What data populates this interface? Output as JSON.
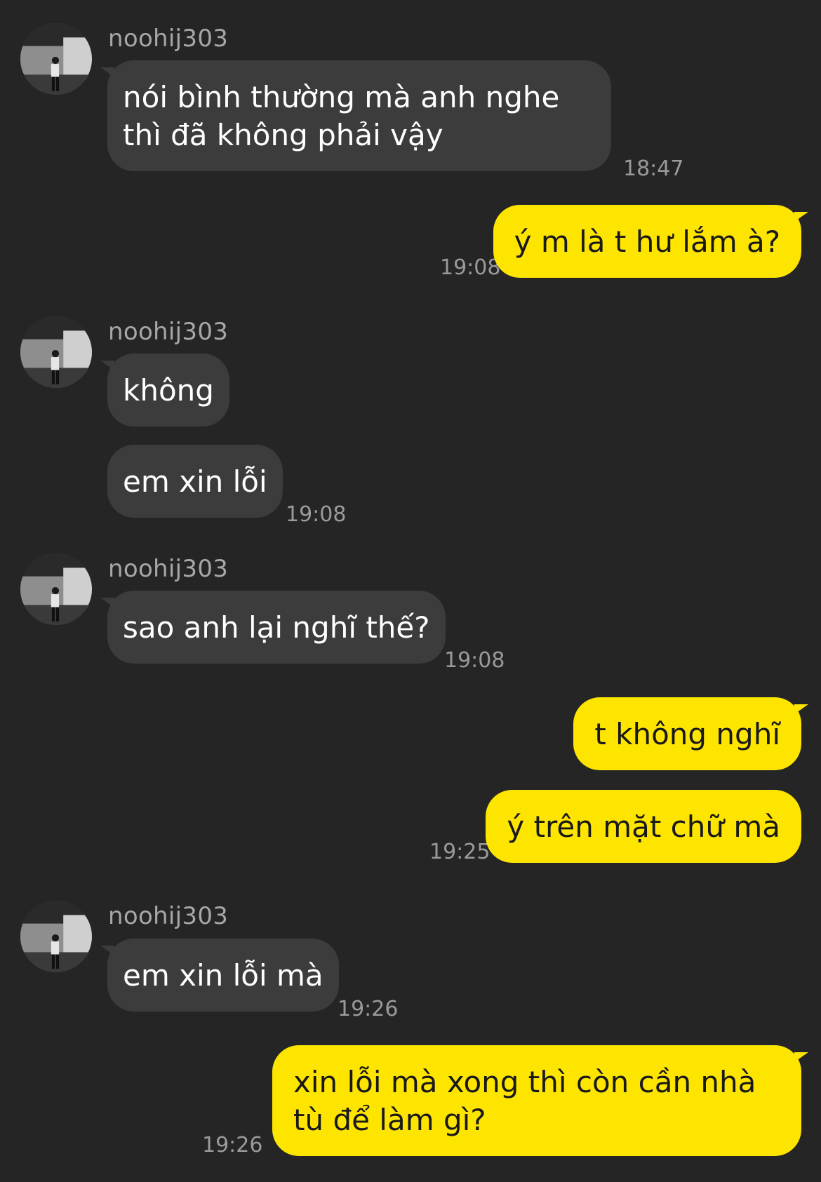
{
  "colors": {
    "background": "#252525",
    "incoming_bubble": "#3c3c3c",
    "outgoing_bubble": "#fee500",
    "timestamp": "#9a9a9a",
    "sender_name": "#a7a7a7"
  },
  "contact": {
    "name": "noohij303",
    "avatar_icon": "profile-photo"
  },
  "messages": [
    {
      "direction": "in",
      "text": "nói bình thường mà anh nghe thì đã không phải vậy",
      "time": "18:47"
    },
    {
      "direction": "out",
      "text": "ý m là t hư lắm à?",
      "time": "19:08"
    },
    {
      "direction": "in",
      "text": "không"
    },
    {
      "direction": "in",
      "text": "em xin lỗi",
      "time": "19:08"
    },
    {
      "direction": "in",
      "text": "sao anh lại nghĩ thế?",
      "time": "19:08"
    },
    {
      "direction": "out",
      "text": "t không nghĩ"
    },
    {
      "direction": "out",
      "text": "ý trên mặt chữ mà",
      "time": "19:25"
    },
    {
      "direction": "in",
      "text": "em xin lỗi mà",
      "time": "19:26"
    },
    {
      "direction": "out",
      "text": "xin lỗi mà xong thì còn cần nhà tù để làm gì?",
      "time": "19:26"
    }
  ]
}
